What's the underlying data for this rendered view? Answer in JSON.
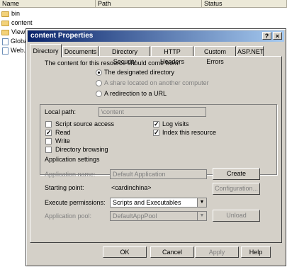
{
  "list": {
    "columns": [
      "Name",
      "Path",
      "Status"
    ],
    "items": [
      {
        "label": "bin",
        "icon": "folder-icon",
        "selected": false
      },
      {
        "label": "content",
        "icon": "folder-icon",
        "selected": false
      },
      {
        "label": "Views",
        "icon": "folder-icon",
        "selected": true
      },
      {
        "label": "Global",
        "icon": "file-icon",
        "selected": false
      },
      {
        "label": "Web.c",
        "icon": "file-icon",
        "selected": false
      }
    ]
  },
  "dialog": {
    "title": "content Properties",
    "help_btn": "?",
    "close_btn": "×",
    "tabs": [
      "Directory",
      "Documents",
      "Directory Security",
      "HTTP Headers",
      "Custom Errors",
      "ASP.NET"
    ],
    "source_label": "The content for this resource should come from:",
    "sources": [
      "The designated directory",
      "A share located on another computer",
      "A redirection to a URL"
    ],
    "local_path_label": "Local path:",
    "local_path_value": "\\content",
    "checks_left": [
      {
        "label": "Script source access",
        "checked": false
      },
      {
        "label": "Read",
        "checked": true
      },
      {
        "label": "Write",
        "checked": false
      },
      {
        "label": "Directory browsing",
        "checked": false
      }
    ],
    "checks_right": [
      {
        "label": "Log visits",
        "checked": true
      },
      {
        "label": "Index this resource",
        "checked": true
      }
    ],
    "app_settings_label": "Application settings",
    "app_name_label": "Application name:",
    "app_name_value": "Default Application",
    "create_btn": "Create",
    "starting_point_label": "Starting point:",
    "starting_point_value": "<cardinchina>",
    "configuration_btn": "Configuration...",
    "exec_perm_label": "Execute permissions:",
    "exec_perm_value": "Scripts and Executables",
    "app_pool_label": "Application pool:",
    "app_pool_value": "DefaultAppPool",
    "unload_btn": "Unload",
    "ok_btn": "OK",
    "cancel_btn": "Cancel",
    "apply_btn": "Apply",
    "help_bottom_btn": "Help",
    "check_mark": "✓",
    "dropdown_arrow": "▼"
  }
}
